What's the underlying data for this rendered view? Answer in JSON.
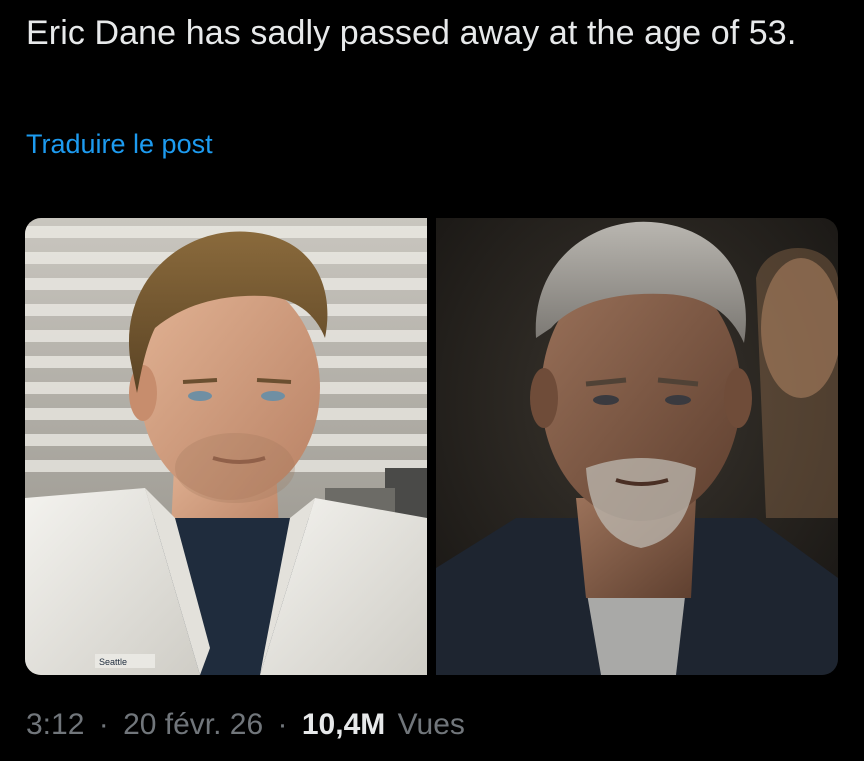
{
  "post": {
    "text": "Eric Dane has sadly passed away at the age of 53.",
    "translate_label": "Traduire le post"
  },
  "media": {
    "photos": [
      {
        "icon": "portrait-photo-scrubs",
        "badge": "Seattle"
      },
      {
        "icon": "portrait-photo-jacket"
      }
    ]
  },
  "meta": {
    "time": "3:12",
    "separator": "·",
    "date": "20 févr. 26",
    "views_count": "10,4M",
    "views_label": "Vues"
  },
  "colors": {
    "background": "#000000",
    "text": "#e7e9ea",
    "link": "#1d9bf0",
    "muted": "#71767b"
  }
}
